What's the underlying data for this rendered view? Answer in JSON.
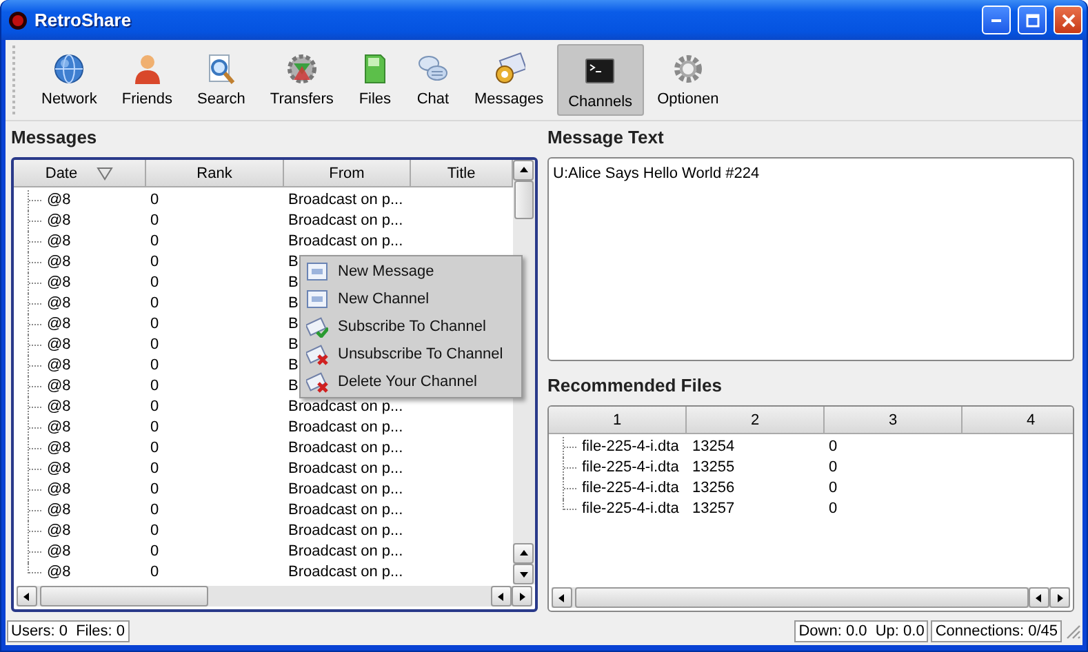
{
  "window": {
    "title": "RetroShare"
  },
  "toolbar": [
    {
      "label": "Network",
      "kind": "globe",
      "selected": false
    },
    {
      "label": "Friends",
      "kind": "person",
      "selected": false
    },
    {
      "label": "Search",
      "kind": "search",
      "selected": false
    },
    {
      "label": "Transfers",
      "kind": "gears",
      "selected": false
    },
    {
      "label": "Files",
      "kind": "document",
      "selected": false
    },
    {
      "label": "Chat",
      "kind": "chat",
      "selected": false
    },
    {
      "label": "Messages",
      "kind": "envelope",
      "selected": false
    },
    {
      "label": "Channels",
      "kind": "terminal",
      "selected": true
    },
    {
      "label": "Optionen",
      "kind": "settings",
      "selected": false
    }
  ],
  "messages": {
    "title": "Messages",
    "columns": [
      {
        "label": "Date",
        "sorted": true
      },
      {
        "label": "Rank",
        "sorted": false
      },
      {
        "label": "From",
        "sorted": false
      },
      {
        "label": "Title",
        "sorted": false
      }
    ],
    "rows": [
      {
        "date": "@8",
        "rank": "0",
        "from": "Broadcast on p..."
      },
      {
        "date": "@8",
        "rank": "0",
        "from": "Broadcast on p..."
      },
      {
        "date": "@8",
        "rank": "0",
        "from": "Broadcast on p..."
      },
      {
        "date": "@8",
        "rank": "0",
        "from": "B"
      },
      {
        "date": "@8",
        "rank": "0",
        "from": "B"
      },
      {
        "date": "@8",
        "rank": "0",
        "from": "B"
      },
      {
        "date": "@8",
        "rank": "0",
        "from": "B"
      },
      {
        "date": "@8",
        "rank": "0",
        "from": "B"
      },
      {
        "date": "@8",
        "rank": "0",
        "from": "B"
      },
      {
        "date": "@8",
        "rank": "0",
        "from": "B"
      },
      {
        "date": "@8",
        "rank": "0",
        "from": "Broadcast on p..."
      },
      {
        "date": "@8",
        "rank": "0",
        "from": "Broadcast on p..."
      },
      {
        "date": "@8",
        "rank": "0",
        "from": "Broadcast on p..."
      },
      {
        "date": "@8",
        "rank": "0",
        "from": "Broadcast on p..."
      },
      {
        "date": "@8",
        "rank": "0",
        "from": "Broadcast on p..."
      },
      {
        "date": "@8",
        "rank": "0",
        "from": "Broadcast on p..."
      },
      {
        "date": "@8",
        "rank": "0",
        "from": "Broadcast on p..."
      },
      {
        "date": "@8",
        "rank": "0",
        "from": "Broadcast on p..."
      },
      {
        "date": "@8",
        "rank": "0",
        "from": "Broadcast on p..."
      }
    ]
  },
  "context_menu": [
    {
      "label": "New Message",
      "kind": "page"
    },
    {
      "label": "New Channel",
      "kind": "page"
    },
    {
      "label": "Subscribe To Channel",
      "kind": "subscribe"
    },
    {
      "label": "Unsubscribe To Channel",
      "kind": "remove"
    },
    {
      "label": "Delete Your Channel",
      "kind": "remove"
    }
  ],
  "message_text": {
    "title": "Message Text",
    "body": "U:Alice Says Hello World #224"
  },
  "recommended_files": {
    "title": "Recommended Files",
    "columns": [
      "1",
      "2",
      "3",
      "4"
    ],
    "rows": [
      [
        "file-225-4-i.dta",
        "13254",
        "0"
      ],
      [
        "file-225-4-i.dta",
        "13255",
        "0"
      ],
      [
        "file-225-4-i.dta",
        "13256",
        "0"
      ],
      [
        "file-225-4-i.dta",
        "13257",
        "0"
      ]
    ]
  },
  "status_bar": {
    "users_files": "Users: 0  Files: 0",
    "rates": "Down: 0.0  Up: 0.0",
    "connections": "Connections: 0/45"
  }
}
